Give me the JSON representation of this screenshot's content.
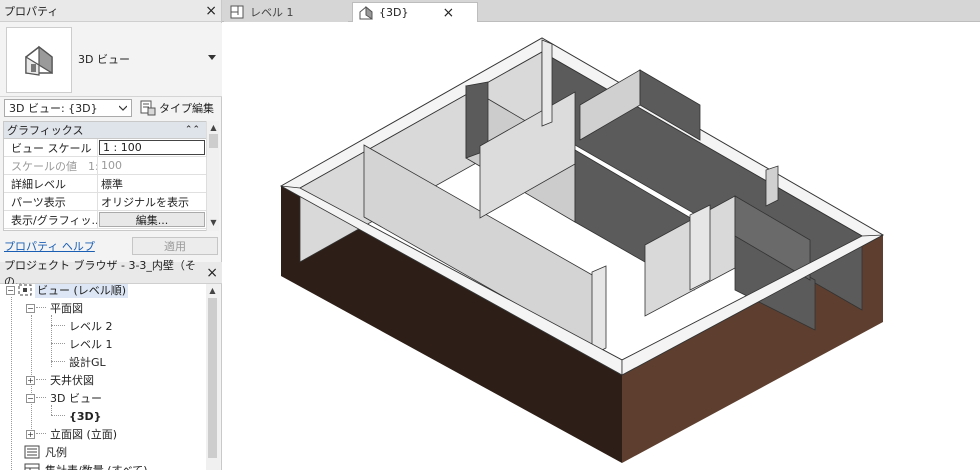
{
  "properties_panel": {
    "title": "プロパティ",
    "close": "×",
    "type_name": "3D ビュー",
    "type_icon": "house-3d-icon",
    "instance_selector": "3D ビュー: {3D}",
    "edit_type": "タイプ編集",
    "category": "グラフィックス",
    "rows": [
      {
        "name": "ビュー スケール",
        "value": "1 : 100"
      },
      {
        "name": "スケールの値　1:",
        "value": "100"
      },
      {
        "name": "詳細レベル",
        "value": "標準"
      },
      {
        "name": "パーツ表示",
        "value": "オリジナルを表示"
      },
      {
        "name": "表示/グラフィッ...",
        "value": "編集..."
      }
    ],
    "help": "プロパティ ヘルプ",
    "apply": "適用"
  },
  "project_browser": {
    "title": "プロジェクト ブラウザ - 3-3_内壁（その...",
    "close": "×",
    "items": [
      {
        "label": "ビュー (レベル順)",
        "expander": "−"
      },
      {
        "label": "平面図",
        "expander": "−"
      },
      {
        "label": "レベル 2"
      },
      {
        "label": "レベル 1"
      },
      {
        "label": "設計GL"
      },
      {
        "label": "天井伏図",
        "expander": "+"
      },
      {
        "label": "3D ビュー",
        "expander": "−"
      },
      {
        "label": "{3D}"
      },
      {
        "label": "立面図 (立面)",
        "expander": "+"
      },
      {
        "label": "凡例"
      },
      {
        "label": "集計表/数量 (すべて)"
      }
    ]
  },
  "tabs": [
    {
      "label": "レベル 1",
      "icon": "floor-plan-icon",
      "active": false
    },
    {
      "label": "{3D}",
      "icon": "house-3d-icon",
      "active": true,
      "close": "×"
    }
  ],
  "colors": {
    "wall_top": "#f4f4f4",
    "wall_light": "#d6d6d6",
    "wall_dark": "#5b5b5b",
    "slab_front": "#2d1e17",
    "slab_side": "#5e3f2f",
    "accent_link": "#1a5fb4"
  }
}
